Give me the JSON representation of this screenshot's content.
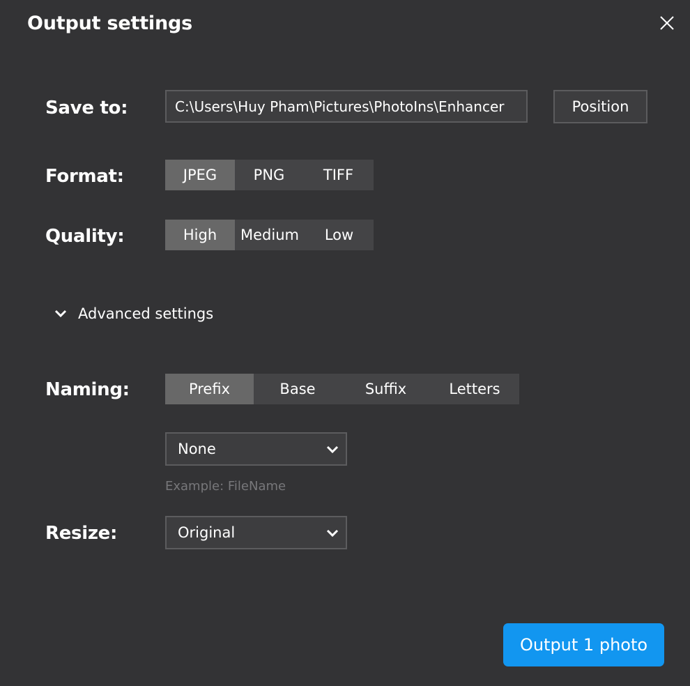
{
  "dialog": {
    "title": "Output settings",
    "close_icon": "close-icon"
  },
  "save_to": {
    "label": "Save to:",
    "path": "C:\\Users\\Huy Pham\\Pictures\\PhotoIns\\Enhancer",
    "position_label": "Position"
  },
  "format": {
    "label": "Format:",
    "options": [
      "JPEG",
      "PNG",
      "TIFF"
    ],
    "selected": "JPEG"
  },
  "quality": {
    "label": "Quality:",
    "options": [
      "High",
      "Medium",
      "Low"
    ],
    "selected": "High"
  },
  "advanced": {
    "label": "Advanced settings",
    "icon": "chevron-down-icon"
  },
  "naming": {
    "label": "Naming:",
    "options": [
      "Prefix",
      "Base",
      "Suffix",
      "Letters"
    ],
    "selected": "Prefix",
    "dropdown_value": "None",
    "example": "Example: FileName"
  },
  "resize": {
    "label": "Resize:",
    "dropdown_value": "Original"
  },
  "footer": {
    "output_label": "Output 1 photo"
  },
  "colors": {
    "background": "#333335",
    "segment_bg": "#444446",
    "segment_active": "#686868",
    "primary_button": "#1296f0",
    "muted_text": "#77777a"
  }
}
